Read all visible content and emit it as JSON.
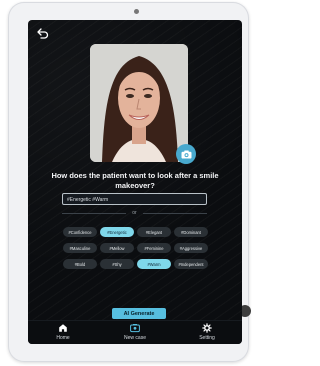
{
  "question": "How does the patient want to look after a smile makeover?",
  "tag_input": {
    "value": "#Energetic #Warm"
  },
  "divider_text": "or",
  "chips": [
    {
      "label": "#Confidence",
      "selected": false
    },
    {
      "label": "#Energetic",
      "selected": true
    },
    {
      "label": "#Elegant",
      "selected": false
    },
    {
      "label": "#Dominant",
      "selected": false
    },
    {
      "label": "#Masculine",
      "selected": false
    },
    {
      "label": "#Mellow",
      "selected": false
    },
    {
      "label": "#Feminine",
      "selected": false
    },
    {
      "label": "#Aggressive",
      "selected": false
    },
    {
      "label": "#Bold",
      "selected": false
    },
    {
      "label": "#Shy",
      "selected": false
    },
    {
      "label": "#Warm",
      "selected": true
    },
    {
      "label": "#Independent",
      "selected": false
    }
  ],
  "generate_label": "AI Generate",
  "nav": {
    "home": "Home",
    "new_case": "New case",
    "setting": "Setting"
  },
  "colors": {
    "accent": "#57bfe0",
    "chip_selected": "#7fd7ea",
    "screen_bg": "#0b0d10"
  }
}
